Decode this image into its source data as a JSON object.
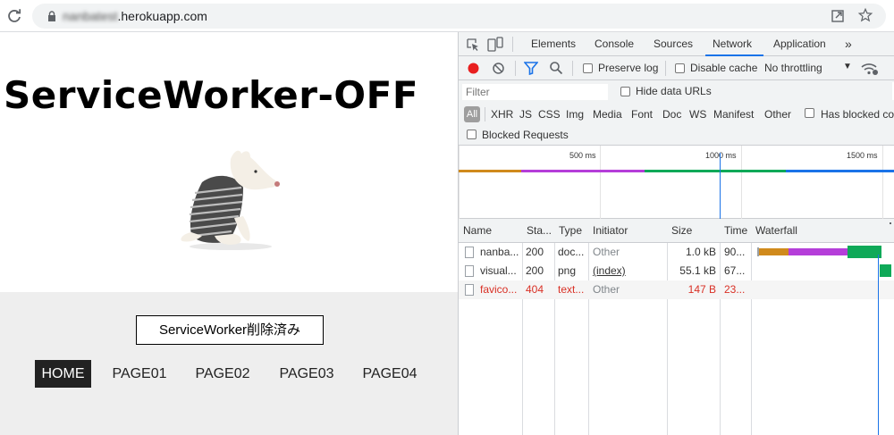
{
  "browser": {
    "url_blurred": "nanbatest",
    "url_domain": ".herokuapp.com"
  },
  "page": {
    "title": "ServiceWorker-OFF",
    "sw_button_label": "ServiceWorker削除済み",
    "nav": [
      "HOME",
      "PAGE01",
      "PAGE02",
      "PAGE03",
      "PAGE04"
    ]
  },
  "devtools": {
    "tabs": [
      "Elements",
      "Console",
      "Sources",
      "Network",
      "Application",
      "»"
    ],
    "active_tab": "Network",
    "toolbar": {
      "preserve_log": "Preserve log",
      "disable_cache": "Disable cache",
      "throttling": "No throttling"
    },
    "filter": {
      "placeholder": "Filter",
      "hide_data_urls": "Hide data URLs",
      "types": [
        "All",
        "XHR",
        "JS",
        "CSS",
        "Img",
        "Media",
        "Font",
        "Doc",
        "WS",
        "Manifest",
        "Other"
      ],
      "has_blocked_cookies": "Has blocked cookies",
      "blocked_requests": "Blocked Requests"
    },
    "overview": {
      "ticks": [
        "500 ms",
        "1000 ms",
        "1500 ms"
      ]
    },
    "columns": [
      "Name",
      "Sta...",
      "Type",
      "Initiator",
      "Size",
      "Time",
      "Waterfall"
    ],
    "rows": [
      {
        "name": "nanba...",
        "status": "200",
        "type": "doc...",
        "initiator": "Other",
        "size": "1.0 kB",
        "time": "90..."
      },
      {
        "name": "visual...",
        "status": "200",
        "type": "png",
        "initiator": "(index)",
        "size": "55.1 kB",
        "time": "67..."
      },
      {
        "name": "favico...",
        "status": "404",
        "type": "text...",
        "initiator": "Other",
        "size": "147 B",
        "time": "23..."
      }
    ],
    "colors": {
      "waiting": "#d08a1c",
      "ttfb": "#b53ed9",
      "download": "#0fa958",
      "blue": "#1a73e8",
      "error": "#d93025"
    }
  }
}
